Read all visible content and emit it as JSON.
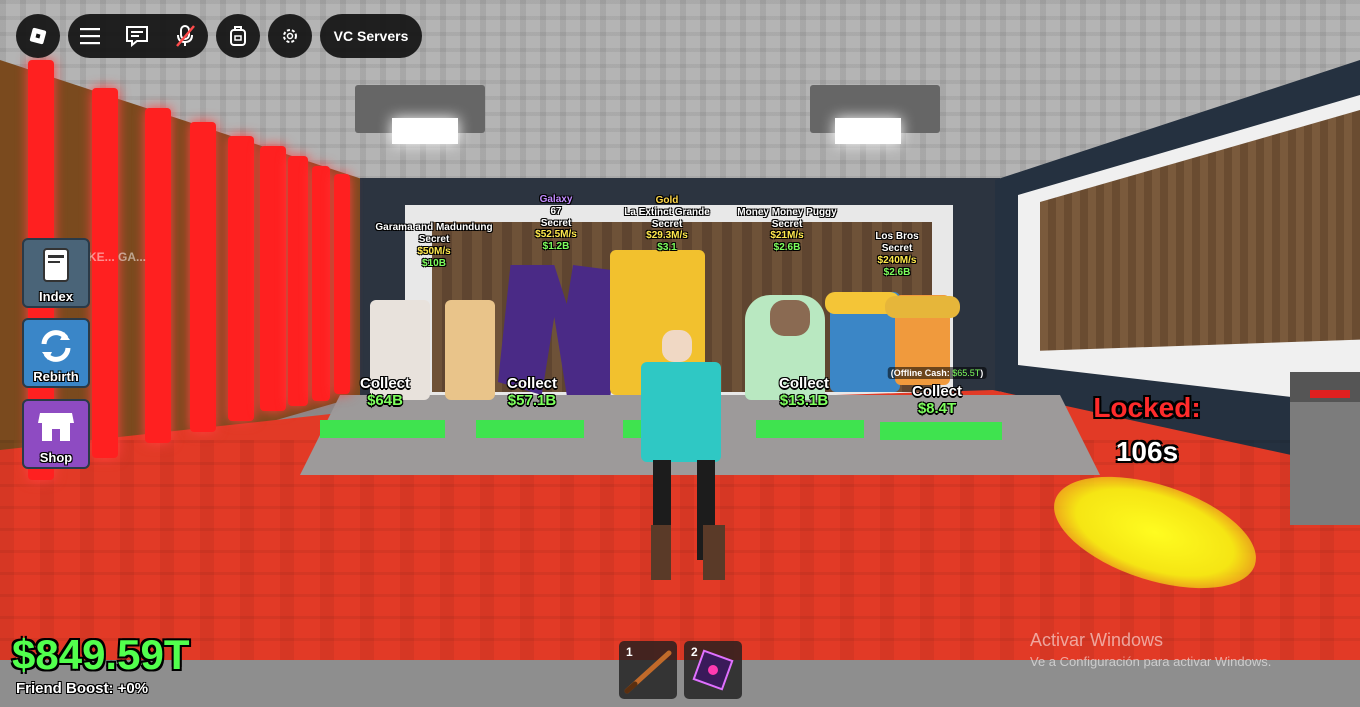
{
  "topbar": {
    "roblox_icon": "roblox-logo-icon",
    "menu_icon": "hamburger-icon",
    "chat_icon": "chat-icon",
    "mic_icon": "mic-muted-icon",
    "backpack_icon": "backpack-icon",
    "settings_icon": "gear-icon",
    "vc_servers_label": "VC Servers"
  },
  "side_menu": {
    "index_label": "Index",
    "rebirth_label": "Rebirth",
    "shop_label": "Shop"
  },
  "background_sign": "KE... GA...",
  "brainrots": [
    {
      "name": "Garama and Madundung",
      "rarity": "Secret",
      "rate": "$50M/s",
      "price": "$10B",
      "collect_label": "Collect",
      "collect_amount": "$64B"
    },
    {
      "mutation": "Galaxy",
      "name": "67",
      "rarity": "Secret",
      "rate": "$52.5M/s",
      "price": "$1.2B",
      "collect_label": "Collect",
      "collect_amount": "$57.1B"
    },
    {
      "mutation": "Gold",
      "name": "La Extinct Grande",
      "rarity": "Secret",
      "rate": "$29.3M/s",
      "price": "$3.1",
      "collect_label": "",
      "collect_amount": ""
    },
    {
      "name": "Money Money Puggy",
      "rarity": "Secret",
      "rate": "$21M/s",
      "price": "$2.6B",
      "collect_label": "Collect",
      "collect_amount": "$13.1B"
    },
    {
      "name": "Los Bros",
      "rarity": "Secret",
      "rate": "$240M/s",
      "price": "$2.6B",
      "collect_label": "Collect",
      "collect_amount": "$8.4T",
      "offline_label": "(Offline Cash: ",
      "offline_amount": "$65.5T",
      "offline_close": ")"
    }
  ],
  "base": {
    "locked_label": "Locked:",
    "locked_time": "106s"
  },
  "player": {
    "money": "$849.59T",
    "friend_boost": "Friend Boost: +0%"
  },
  "hotbar": [
    {
      "slot": "1",
      "item_icon": "bat-icon"
    },
    {
      "slot": "2",
      "item_icon": "galaxy-cube-icon"
    }
  ],
  "windows_watermark": {
    "line1": "Activar Windows",
    "line2": "Ve a Configuración para activar Windows."
  },
  "colors": {
    "money_green": "#52ff4d",
    "locked_red": "#ff2b2b",
    "floor_red": "#e23a26",
    "pad_green": "#3fe34f"
  }
}
